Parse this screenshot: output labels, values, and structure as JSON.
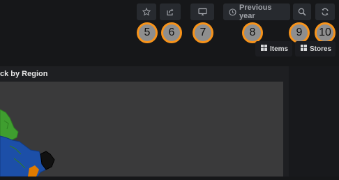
{
  "toolbar": {
    "time_range_label": "Previous year",
    "icons": [
      "star-icon",
      "share-icon",
      "monitor-icon",
      "clock-icon",
      "zoom-out-icon",
      "refresh-icon"
    ]
  },
  "badges": [
    "5",
    "6",
    "7",
    "8",
    "9",
    "10"
  ],
  "badge_colors": {
    "fill": "#8e8e8e",
    "ring": "#f7931a"
  },
  "sub_buttons": [
    {
      "label": "Items",
      "icon": "grid-icon"
    },
    {
      "label": "Stores",
      "icon": "grid-icon"
    }
  ],
  "panel": {
    "title": "ck by Region"
  },
  "map_colors": [
    "#3f9e2f",
    "#1c4fa8",
    "#111111",
    "#e07b00"
  ]
}
